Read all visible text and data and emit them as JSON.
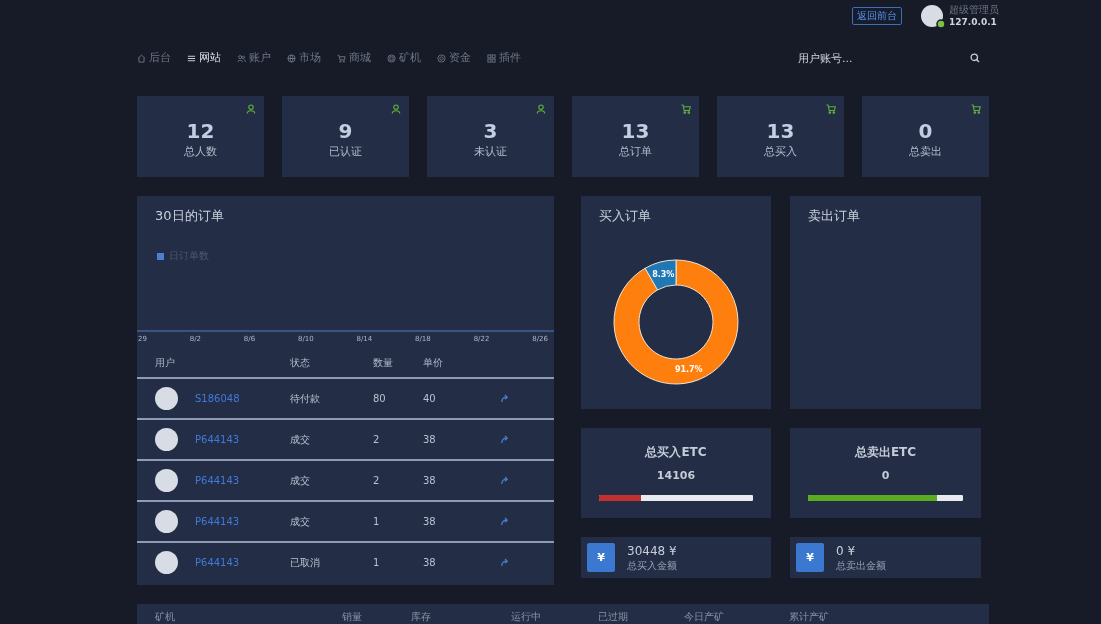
{
  "top_bar": {
    "return_button": "返回前台",
    "user": {
      "name": "超级管理员",
      "ip": "127.0.0.1",
      "online": true
    }
  },
  "nav": {
    "items": [
      {
        "label": "后台",
        "selected": false
      },
      {
        "label": "网站",
        "selected": true
      },
      {
        "label": "账户",
        "selected": false
      },
      {
        "label": "市场",
        "selected": false
      },
      {
        "label": "商城",
        "selected": false
      },
      {
        "label": "矿机",
        "selected": false
      },
      {
        "label": "资金",
        "selected": false
      },
      {
        "label": "插件",
        "selected": false
      }
    ],
    "search": {
      "placeholder": "用户账号..."
    }
  },
  "stats": [
    {
      "value": "12",
      "label": "总人数",
      "kind": "member"
    },
    {
      "value": "9",
      "label": "已认证",
      "kind": "member"
    },
    {
      "value": "3",
      "label": "未认证",
      "kind": "member"
    },
    {
      "value": "13",
      "label": "总订单",
      "kind": "order"
    },
    {
      "value": "13",
      "label": "总买入",
      "kind": "order"
    },
    {
      "value": "0",
      "label": "总卖出",
      "kind": "order"
    }
  ],
  "order_chart": {
    "title": "30日的订单",
    "legend": "日订单数",
    "x_labels": [
      "29",
      "8/2",
      "8/6",
      "8/10",
      "8/14",
      "8/18",
      "8/22",
      "8/26"
    ]
  },
  "orders_table": {
    "columns": [
      "用户",
      "状态",
      "数量",
      "单价"
    ],
    "rows": [
      {
        "user": "S186048",
        "status": "待付款",
        "quantity": "80",
        "price": "40"
      },
      {
        "user": "P644143",
        "status": "成交",
        "quantity": "2",
        "price": "38"
      },
      {
        "user": "P644143",
        "status": "成交",
        "quantity": "2",
        "price": "38"
      },
      {
        "user": "P644143",
        "status": "成交",
        "quantity": "1",
        "price": "38"
      },
      {
        "user": "P644143",
        "status": "已取消",
        "quantity": "1",
        "price": "38"
      }
    ]
  },
  "buy_orders": {
    "title": "买入订单",
    "chart_data": {
      "type": "donut",
      "values": [
        91.7,
        8.3
      ],
      "value_labels": [
        "91.7%",
        "8.3%"
      ],
      "colors": [
        "#ff7f0e",
        "#1f77b4"
      ]
    }
  },
  "sell_orders": {
    "title": "卖出订单"
  },
  "etc_totals": [
    {
      "title": "总买入ETC",
      "value": "14106",
      "level": 0.27,
      "color": "#c0302f"
    },
    {
      "title": "总卖出ETC",
      "value": "0",
      "level": 0.83,
      "color": "#5aab1e"
    }
  ],
  "amounts": [
    {
      "icon_text": "¥",
      "value": "30448 ¥",
      "label": "总买入金额"
    },
    {
      "icon_text": "¥",
      "value": "0 ¥",
      "label": "总卖出金额"
    }
  ],
  "miner_table": {
    "columns": [
      "矿机",
      "销量",
      "库存",
      "运行中",
      "已过期",
      "今日产矿",
      "累计产矿"
    ]
  }
}
